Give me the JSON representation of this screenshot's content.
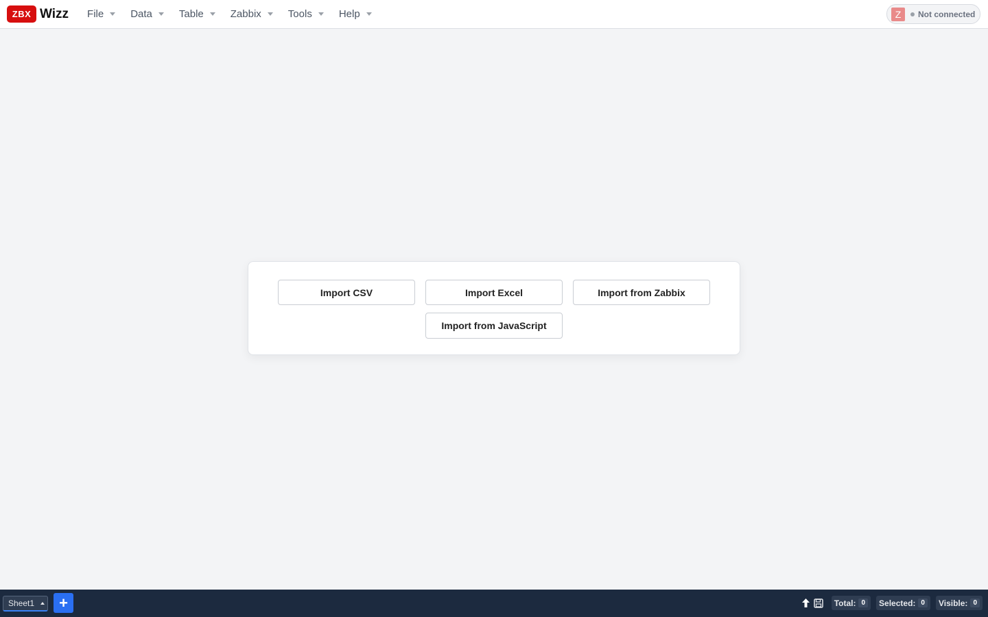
{
  "brand": {
    "badge": "ZBX",
    "name": "Wizz"
  },
  "menu": [
    {
      "label": "File"
    },
    {
      "label": "Data"
    },
    {
      "label": "Table"
    },
    {
      "label": "Zabbix"
    },
    {
      "label": "Tools"
    },
    {
      "label": "Help"
    }
  ],
  "connection": {
    "logo": "Z",
    "status": "Not connected",
    "status_color": "#9aa0a8"
  },
  "import": {
    "csv": "Import CSV",
    "excel": "Import Excel",
    "zabbix": "Import from Zabbix",
    "javascript": "Import from JavaScript"
  },
  "footer": {
    "sheet_label": "Sheet1",
    "add_sheet": "+",
    "total_label": "Total:",
    "total_value": "0",
    "selected_label": "Selected:",
    "selected_value": "0",
    "visible_label": "Visible:",
    "visible_value": "0",
    "icons": [
      "upload-icon",
      "save-icon"
    ]
  },
  "colors": {
    "brand": "#d70f0f",
    "accent": "#2a6ff2",
    "footer_bg": "#1c2a3f"
  }
}
